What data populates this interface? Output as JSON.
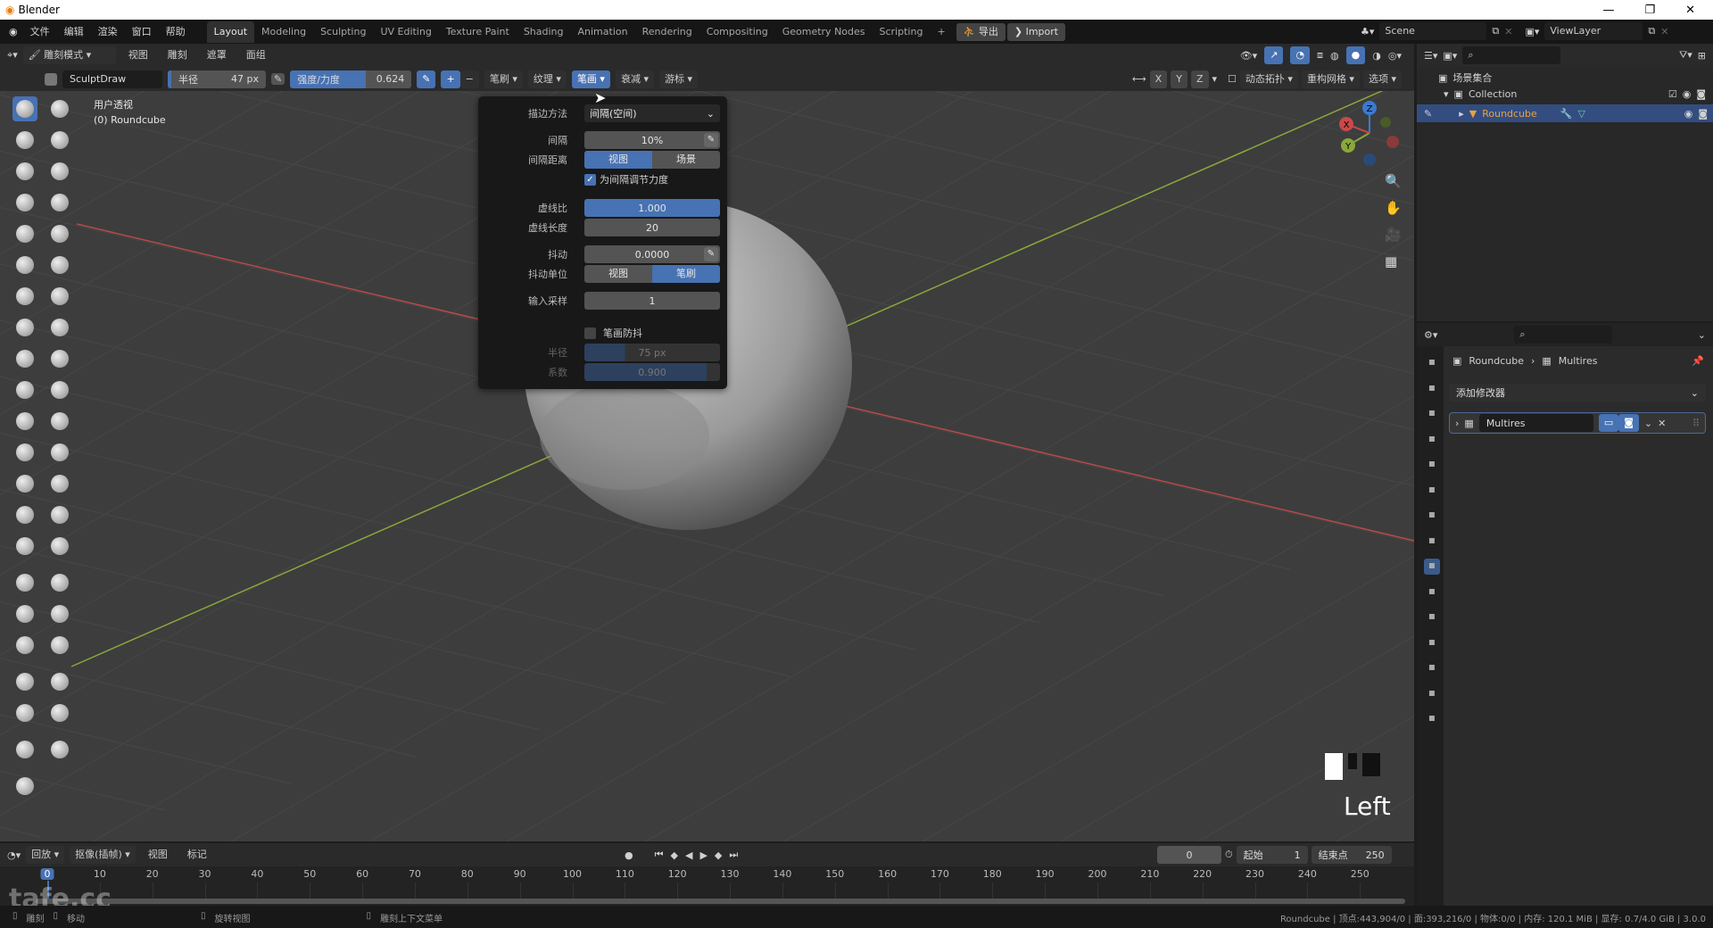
{
  "app_title": "Blender",
  "window_controls": [
    "—",
    "❐",
    "✕"
  ],
  "menu": [
    "文件",
    "编辑",
    "渲染",
    "窗口",
    "帮助"
  ],
  "workspaces": [
    "Layout",
    "Modeling",
    "Sculpting",
    "UV Editing",
    "Texture Paint",
    "Shading",
    "Animation",
    "Rendering",
    "Compositing",
    "Geometry Nodes",
    "Scripting",
    "+"
  ],
  "export_label": "导出",
  "import_label": "Import",
  "scene": "Scene",
  "view_layer": "ViewLayer",
  "viewport_header": {
    "mode": "雕刻模式",
    "menus": [
      "视图",
      "雕刻",
      "遮罩",
      "面组"
    ],
    "brush_name": "SculptDraw",
    "radius_label": "半径",
    "radius_value": "47 px",
    "strength_label": "强度/力度",
    "strength_value": "0.624",
    "plus": "+",
    "minus": "−",
    "dropdowns": [
      "笔刷",
      "纹理",
      "笔画",
      "衰减",
      "游标"
    ],
    "active_dropdown": "笔画",
    "axes": [
      "X",
      "Y",
      "Z"
    ],
    "right_dropdowns": [
      "动态拓扑",
      "重构网格",
      "选项"
    ]
  },
  "viewport_overlay": {
    "view_name": "用户透视",
    "object": "(0) Roundcube",
    "view_label": "Left"
  },
  "colors": {
    "accent": "#4772b3",
    "x_axis": "#b94a4a",
    "y_axis": "#8aa83a",
    "selected_object": "#e8a33d"
  },
  "tools": [
    "draw",
    "draw-sharp",
    "clay",
    "clay-strips",
    "clay-thumb",
    "layer",
    "inflate",
    "blob",
    "crease",
    "smooth",
    "flatten",
    "fill",
    "scrape",
    "multiplane-scrape",
    "pinch",
    "grab",
    "elastic-deform",
    "snake-hook",
    "thumb",
    "pose",
    "nudge",
    "rotate",
    "slide-relax",
    "boundary",
    "cloth",
    "simplify",
    "mask",
    "draw-face-sets",
    "box-mask",
    "lasso-mask",
    "box-hide",
    "box-face-set",
    "line-project",
    "mesh-filter",
    "cloth-filter",
    "color-filter",
    "edit-face-set",
    "mask-by-color",
    "move",
    "rotate-transform",
    "scale",
    "transform",
    "annotate"
  ],
  "stroke_popover": {
    "stroke_method_label": "描边方法",
    "stroke_method_value": "间隔(空间)",
    "spacing_label": "间隔",
    "spacing_value": "10%",
    "spacing_distance_label": "间隔距离",
    "spacing_distance_options": [
      "视图",
      "场景"
    ],
    "spacing_distance_selected": "视图",
    "adjust_strength_label": "为间隔调节力度",
    "adjust_strength_checked": true,
    "dash_ratio_label": "虚线比",
    "dash_ratio_value": "1.000",
    "dash_length_label": "虚线长度",
    "dash_length_value": "20",
    "jitter_label": "抖动",
    "jitter_value": "0.0000",
    "jitter_unit_label": "抖动单位",
    "jitter_unit_options": [
      "视图",
      "笔刷"
    ],
    "jitter_unit_selected": "笔刷",
    "input_samples_label": "输入采样",
    "input_samples_value": "1",
    "stabilize_label": "笔画防抖",
    "stabilize_checked": false,
    "stab_radius_label": "半径",
    "stab_radius_value": "75 px",
    "stab_radius_fraction": 0.3,
    "stab_factor_label": "系数",
    "stab_factor_value": "0.900",
    "stab_factor_fraction": 0.9
  },
  "outliner": {
    "root": "场景集合",
    "collection": "Collection",
    "object": "Roundcube"
  },
  "properties": {
    "breadcrumb_object": "Roundcube",
    "breadcrumb_modifier": "Multires",
    "add_modifier": "添加修改器",
    "modifier_name": "Multires"
  },
  "timeline": {
    "menus": [
      "回放",
      "抠像(插帧)",
      "视图",
      "标记"
    ],
    "current_frame": "0",
    "start_label": "起始",
    "start": "1",
    "end_label": "结束点",
    "end": "250",
    "ticks": [
      "0",
      "10",
      "20",
      "30",
      "40",
      "50",
      "60",
      "70",
      "80",
      "90",
      "100",
      "110",
      "120",
      "130",
      "140",
      "150",
      "160",
      "170",
      "180",
      "190",
      "200",
      "210",
      "220",
      "230",
      "240",
      "250"
    ]
  },
  "statusbar": {
    "hints": [
      "雕刻",
      "移动",
      "旋转视图",
      "雕刻上下文菜单"
    ],
    "stats": "Roundcube | 顶点:443,904/0 | 面:393,216/0 | 物体:0/0 | 内存: 120.1 MiB | 显存: 0.7/4.0 GiB | 3.0.0"
  },
  "watermark": "tafe.cc"
}
